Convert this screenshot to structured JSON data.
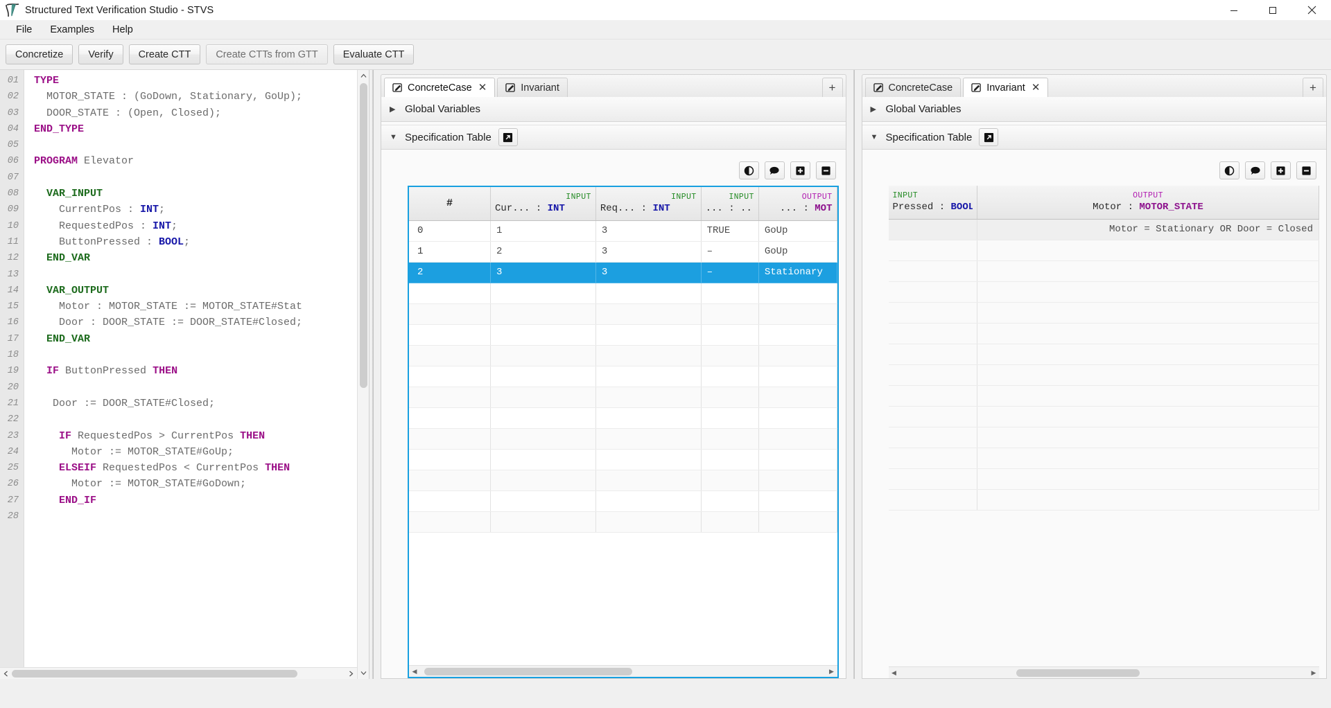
{
  "window": {
    "title": "Structured Text Verification Studio - STVS",
    "logo_icon": "stvs-logo-icon",
    "minimize_icon": "minimize-icon",
    "maximize_icon": "maximize-icon",
    "close_icon": "close-icon"
  },
  "menu": {
    "items": [
      {
        "label": "File"
      },
      {
        "label": "Examples"
      },
      {
        "label": "Help"
      }
    ]
  },
  "toolbar": {
    "buttons": [
      {
        "label": "Concretize",
        "enabled": true
      },
      {
        "label": "Verify",
        "enabled": true
      },
      {
        "label": "Create CTT",
        "enabled": true
      },
      {
        "label": "Create CTTs from GTT",
        "enabled": false
      },
      {
        "label": "Evaluate CTT",
        "enabled": true
      }
    ]
  },
  "editor": {
    "lines": [
      {
        "num": "01",
        "html": "<span class='kw'>TYPE</span>"
      },
      {
        "num": "02",
        "html": "  MOTOR_STATE : (GoDown, Stationary, GoUp);"
      },
      {
        "num": "03",
        "html": "  DOOR_STATE : (Open, Closed);"
      },
      {
        "num": "04",
        "html": "<span class='kw'>END_TYPE</span>"
      },
      {
        "num": "05",
        "html": ""
      },
      {
        "num": "06",
        "html": "<span class='kw'>PROGRAM</span> Elevator"
      },
      {
        "num": "07",
        "html": ""
      },
      {
        "num": "08",
        "html": "  <span class='kw2'>VAR_INPUT</span>"
      },
      {
        "num": "09",
        "html": "    CurrentPos : <span class='ty'>INT</span>;"
      },
      {
        "num": "10",
        "html": "    RequestedPos : <span class='ty'>INT</span>;"
      },
      {
        "num": "11",
        "html": "    ButtonPressed : <span class='ty'>BOOL</span>;"
      },
      {
        "num": "12",
        "html": "  <span class='kw2'>END_VAR</span>"
      },
      {
        "num": "13",
        "html": ""
      },
      {
        "num": "14",
        "html": "  <span class='kw2'>VAR_OUTPUT</span>"
      },
      {
        "num": "15",
        "html": "    Motor : MOTOR_STATE := MOTOR_STATE#Stat"
      },
      {
        "num": "16",
        "html": "    Door : DOOR_STATE := DOOR_STATE#Closed;"
      },
      {
        "num": "17",
        "html": "  <span class='kw2'>END_VAR</span>"
      },
      {
        "num": "18",
        "html": ""
      },
      {
        "num": "19",
        "html": "  <span class='kw'>IF</span> ButtonPressed <span class='kw'>THEN</span>"
      },
      {
        "num": "20",
        "html": ""
      },
      {
        "num": "21",
        "html": "   Door := DOOR_STATE#Closed;"
      },
      {
        "num": "22",
        "html": ""
      },
      {
        "num": "23",
        "html": "    <span class='kw'>IF</span> RequestedPos &gt; CurrentPos <span class='kw'>THEN</span>"
      },
      {
        "num": "24",
        "html": "      Motor := MOTOR_STATE#GoUp;"
      },
      {
        "num": "25",
        "html": "    <span class='kw'>ELSEIF</span> RequestedPos &lt; CurrentPos <span class='kw'>THEN</span>"
      },
      {
        "num": "26",
        "html": "      Motor := MOTOR_STATE#GoDown;"
      },
      {
        "num": "27",
        "html": "    <span class='kw'>END_IF</span>"
      },
      {
        "num": "28",
        "html": ""
      }
    ],
    "scroll_up_icon": "chevron-up-icon",
    "scroll_down_icon": "chevron-down-icon",
    "scroll_left_icon": "chevron-left-icon",
    "scroll_right_icon": "chevron-right-icon"
  },
  "middle_panel": {
    "tabs": [
      {
        "label": "ConcreteCase",
        "active": true,
        "closable": true,
        "icon": "pencil-square-icon"
      },
      {
        "label": "Invariant",
        "active": false,
        "closable": false,
        "icon": "pencil-square-icon"
      }
    ],
    "add_tab_label": "+",
    "sections": [
      {
        "label": "Global Variables",
        "expanded": false,
        "arrow": "▶"
      },
      {
        "label": "Specification Table",
        "expanded": true,
        "arrow": "▼",
        "popout_icon": "popout-icon"
      }
    ],
    "table_tools": [
      {
        "icon": "contrast-icon"
      },
      {
        "icon": "comment-icon"
      },
      {
        "icon": "plus-square-icon"
      },
      {
        "icon": "minus-square-icon"
      }
    ],
    "table": {
      "columns": [
        {
          "category": "",
          "name": "#",
          "type": "",
          "is_index": true
        },
        {
          "category": "INPUT",
          "name": "Cur...",
          "type": "INT",
          "type_color": "blue"
        },
        {
          "category": "INPUT",
          "name": "Req...",
          "type": "INT",
          "type_color": "blue"
        },
        {
          "category": "INPUT",
          "name": "...",
          "type": "...",
          "type_color": "plain"
        },
        {
          "category": "OUTPUT",
          "name": "...",
          "type": "MOT",
          "type_color": "purple"
        }
      ],
      "rows": [
        {
          "index": "0",
          "cells": [
            "1",
            "3",
            "TRUE",
            "GoUp"
          ],
          "selected": false
        },
        {
          "index": "1",
          "cells": [
            "2",
            "3",
            "–",
            "GoUp"
          ],
          "selected": false
        },
        {
          "index": "2",
          "cells": [
            "3",
            "3",
            "–",
            "Stationary"
          ],
          "selected": true
        }
      ],
      "empty_row_count": 12
    }
  },
  "right_panel": {
    "tabs": [
      {
        "label": "ConcreteCase",
        "active": false,
        "closable": false,
        "icon": "pencil-square-icon"
      },
      {
        "label": "Invariant",
        "active": true,
        "closable": true,
        "icon": "pencil-square-icon"
      }
    ],
    "add_tab_label": "+",
    "sections": [
      {
        "label": "Global Variables",
        "expanded": false,
        "arrow": "▶"
      },
      {
        "label": "Specification Table",
        "expanded": true,
        "arrow": "▼",
        "popout_icon": "popout-icon"
      }
    ],
    "table_tools": [
      {
        "icon": "contrast-icon"
      },
      {
        "icon": "comment-icon"
      },
      {
        "icon": "plus-square-icon"
      },
      {
        "icon": "minus-square-icon"
      }
    ],
    "table": {
      "columns": [
        {
          "category": "INPUT",
          "name": "Pressed",
          "type": "BOOL",
          "type_color": "blue"
        },
        {
          "category": "OUTPUT",
          "name": "Motor",
          "type": "MOTOR_STATE",
          "type_color": "purple"
        }
      ],
      "invariant_text": "Motor = Stationary OR Door = Closed",
      "empty_row_count": 13
    }
  }
}
